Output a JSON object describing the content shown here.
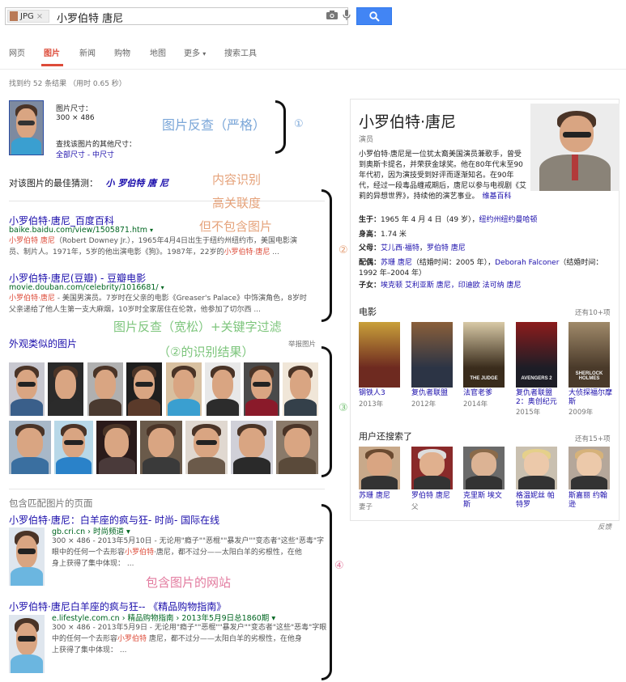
{
  "search": {
    "chip_label": "JPG",
    "chip_close": "×",
    "query": "小罗伯特 唐尼"
  },
  "nav": [
    "网页",
    "图片",
    "新闻",
    "购物",
    "地图",
    "更多",
    "搜索工具"
  ],
  "nav_more_arrow": "▾",
  "stats": "找到约 52 条结果 （用时 0.65 秒）",
  "image_info": {
    "size_label": "图片尺寸：",
    "size_value": "300 × 486",
    "other_sizes_label": "查找该图片的其他尺寸：",
    "other_sizes_links": "全部尺寸 - 中尺寸"
  },
  "best_guess": {
    "label": "对该图片的最佳猜测：",
    "value": "小 罗伯特 唐 尼"
  },
  "annotations": {
    "a1": "图片反查（严格）",
    "n1": "①",
    "a2_1": "内容识别",
    "a2_2": "高关联度",
    "a2_3": "但不包含图片",
    "n2": "②",
    "a3_1": "图片反查（宽松）+关键字过滤",
    "a3_2": "（②的识别结果）",
    "n3": "③",
    "a4": "包含图片的网站",
    "n4": "④"
  },
  "results": [
    {
      "title": "小罗伯特·唐尼_百度百科",
      "url": "baike.baidu.com/view/1505871.htm",
      "line1_hl": "小罗伯特 唐尼",
      "line1": "（Robert Downey Jr.），1965年4月4日出生于纽约州纽约市，美国电影演",
      "line2": "员、制片人。1971年，5岁的他出演电影《狗》。1987年，22岁的",
      "line2_hl": "小罗伯特·唐尼",
      "line2_end": " ..."
    },
    {
      "title": "小罗伯特·唐尼(豆瓣) - 豆瓣电影",
      "url": "movie.douban.com/celebrity/1016681/",
      "line1_hl": "小罗伯特·唐尼",
      "line1": " - 美国男演员。7岁时在父亲的电影《Greaser's Palace》中饰演角色，8岁时",
      "line2": "父亲递给了他人生第一支大麻烟，10岁时全家居住在伦敦，他参加了切尔西 ..."
    }
  ],
  "similar": {
    "title": "外观类似的图片",
    "report": "举报图片"
  },
  "matching": {
    "title": "包含匹配图片的页面",
    "items": [
      {
        "title": "小罗伯特·唐尼：白羊座的疯与狂- 时尚- 国际在线",
        "url": "gb.cri.cn › 时尚频道 ▾",
        "meta": "300 × 486 - 2013年5月10日 - 无论用\"瘾子\"\"恶棍\"\"暴发户\"\"变态者\"这些\"恶毒\"字",
        "line2a": "眼中的任何一个去形容",
        "line2_hl": "小罗伯特",
        "line2b": "·唐尼，都不过分——太阳白羊的劣根性，在他",
        "line3": "身上获得了集中体现： ..."
      },
      {
        "title": "小罗伯特·唐尼白羊座的疯与狂-- 《精品购物指南》",
        "url": "e.lifestyle.com.cn › 精品购物指南 › 2013年5月9日总1860期 ▾",
        "meta": "300 × 486 - 2013年5月9日 - 无论用\"瘾子\"\"恶棍\"\"暴发户\"\"变态者\"这些\"恶毒\"字眼",
        "line2a": "中的任何一个去形容",
        "line2_hl": "小罗伯特",
        "line2b": " 唐尼，都不过分——太阳白羊的劣根性，在他身",
        "line3": "上获得了集中体现： ..."
      }
    ]
  },
  "kp": {
    "title": "小罗伯特·唐尼",
    "subtitle": "演员",
    "desc": "小罗伯特·唐尼是一位犹太裔美国演员兼歌手，曾受到奥斯卡提名，并荣获金球奖。他在80年代末至90年代初，因为演技受到好评而逐渐知名。在90年代，经过一段毒品缠戒期后，唐尼以参与电视剧《艾莉的异想世界》，持续他的演艺事业。",
    "wiki": "维基百科",
    "facts": {
      "birth_label": "生于：",
      "birth_value": "1965 年 4 月 4 日（49 岁），",
      "birth_place": "纽约州纽约曼哈顿",
      "height_label": "身高：",
      "height_value": "1.74 米",
      "parents_label": "父母：",
      "parent1": "艾儿西·福特",
      "parent2": "罗伯特 唐尼",
      "spouse_label": "配偶：",
      "spouse1": "苏珊 唐尼",
      "spouse1_note": "（结婚时间：2005 年），",
      "spouse2": "Deborah Falconer",
      "spouse2_note": "（结婚时间：1992 年–2004 年）",
      "children_label": "子女：",
      "children": "埃克顿 艾利亚斯 唐尼，印迪欧 法可纳 唐尼"
    },
    "movies_title": "电影",
    "movies_more": "还有10+项",
    "movies": [
      {
        "title": "钢铁人3",
        "year": "2013年",
        "color": "#6e2a20",
        "accent": "#c9a03a",
        "poster_text": ""
      },
      {
        "title": "复仇者联盟",
        "year": "2012年",
        "color": "#2c3445",
        "accent": "#8a5f3a",
        "poster_text": ""
      },
      {
        "title": "法官老爹",
        "year": "2014年",
        "color": "#3a2c1c",
        "accent": "#d8c9a6",
        "poster_text": "THE JUDGE"
      },
      {
        "title": "复仇者联盟2：奥创纪元",
        "year": "2015年",
        "color": "#1d1d26",
        "accent": "#8c1c1c",
        "poster_text": "AVENGERS 2"
      },
      {
        "title": "大侦探福尔摩斯",
        "year": "2009年",
        "color": "#4a3a2a",
        "accent": "#a08a6a",
        "poster_text": "SHERLOCK HOLMES"
      }
    ],
    "people_title": "用户还搜索了",
    "people_more": "还有15+项",
    "people": [
      {
        "name": "苏珊 唐尼",
        "rel": "妻子",
        "skin": "#d9a582",
        "hair": "#6b4a30",
        "bg": "#c8a98a"
      },
      {
        "name": "罗伯特 唐尼",
        "rel": "父",
        "skin": "#e0b08e",
        "hair": "#dcdcdc",
        "bg": "#8a2a2a"
      },
      {
        "name": "克里斯 埃文斯",
        "rel": "",
        "skin": "#dcb394",
        "hair": "#8a6a4a",
        "bg": "#6a6a6a"
      },
      {
        "name": "格温妮丝 帕特罗",
        "rel": "",
        "skin": "#ecc9aa",
        "hair": "#e5d08a",
        "bg": "#c9c0b0"
      },
      {
        "name": "斯嘉丽 约翰逊",
        "rel": "",
        "skin": "#ecc9aa",
        "hair": "#d6b27a",
        "bg": "#b5a79a"
      }
    ],
    "feedback": "反馈"
  },
  "colors": {
    "accent": "#dd4b39",
    "link": "#1a0dab",
    "url": "#006621",
    "button": "#4285f4"
  }
}
